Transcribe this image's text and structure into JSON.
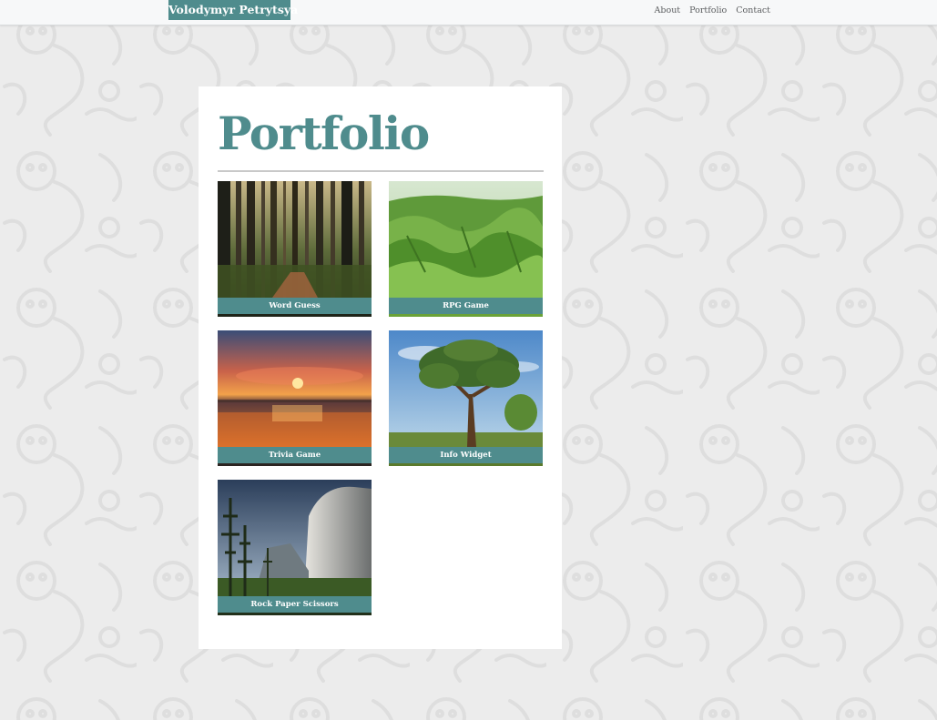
{
  "navbar": {
    "brand": "Volodymyr Petrytsya",
    "links": [
      {
        "label": "About"
      },
      {
        "label": "Portfolio"
      },
      {
        "label": "Contact"
      }
    ]
  },
  "main": {
    "title": "Portfolio",
    "projects": [
      {
        "caption": "Word Guess",
        "image": "forest-image"
      },
      {
        "caption": "RPG Game",
        "image": "green-hills-image"
      },
      {
        "caption": "Trivia Game",
        "image": "sunset-image"
      },
      {
        "caption": "Info Widget",
        "image": "tree-image"
      },
      {
        "caption": "Rock Paper Scissors",
        "image": "cliff-valley-image"
      }
    ]
  },
  "colors": {
    "accent": "#4f8c8d",
    "background": "#ececec",
    "navbar": "#f7f8f9",
    "card": "#ffffff"
  }
}
